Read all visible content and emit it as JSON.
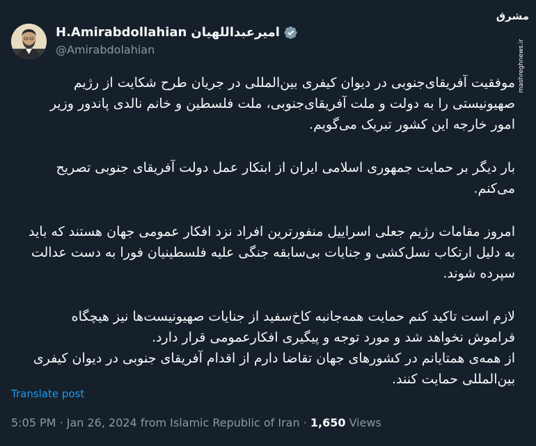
{
  "author": {
    "name": "H.Amirabdollahian",
    "name_fa": "امیرعبداللهیان",
    "handle": "@Amirabdolahian",
    "verified_icon": "verified-badge-icon"
  },
  "watermark": {
    "logo_text": "مشرق",
    "url": "mashreghnews.ir"
  },
  "tweet": {
    "paragraphs": [
      "موفقیت آفریقای‌جنوبی در دیوان کیفری بین‌المللی در جریان طرح شکایت از رژیم صهیونیستی را به دولت و ملت آفریقای‌جنوبی، ملت فلسطین و خانم نالدی پاندور وزیر امور خارجه این کشور تبریک می‌گویم.",
      "بار دیگر بر حمایت جمهوری اسلامی ایران از ابتکار عمل دولت آفریقای جنوبی تصریح می‌کنم.",
      "امروز مقامات رژیم جعلی اسراییل منفورترین افراد نزد افکار عمومی جهان هستند که باید به دلیل ارتکاب نسل‌کشی و جنایات بی‌سابقه جنگی علیه فلسطینیان فورا به دست عدالت سپرده شوند.",
      "لازم است تاکید کنم حمایت همه‌جانبه کاخ‌سفید از جنایات صهیونیست‌ها نیز هیچگاه فراموش نخواهد شد و مورد توجه و پیگیری افکارعمومی قرار دارد.\nاز همه‌ی همتایانم در کشورهای جهان تقاضا دارم از اقدام آفریقای جنوبی در دیوان کیفری بین‌المللی حمایت کنند."
    ],
    "translate_label": "Translate post"
  },
  "meta": {
    "time": "5:05 PM",
    "date": "Jan 26, 2024",
    "location": "from Islamic Republic of Iran",
    "views_count": "1,650",
    "views_label": "Views"
  },
  "colors": {
    "background": "#15202b",
    "text": "#f7f9f9",
    "secondary": "#8b98a5",
    "link": "#1d9bf0"
  }
}
